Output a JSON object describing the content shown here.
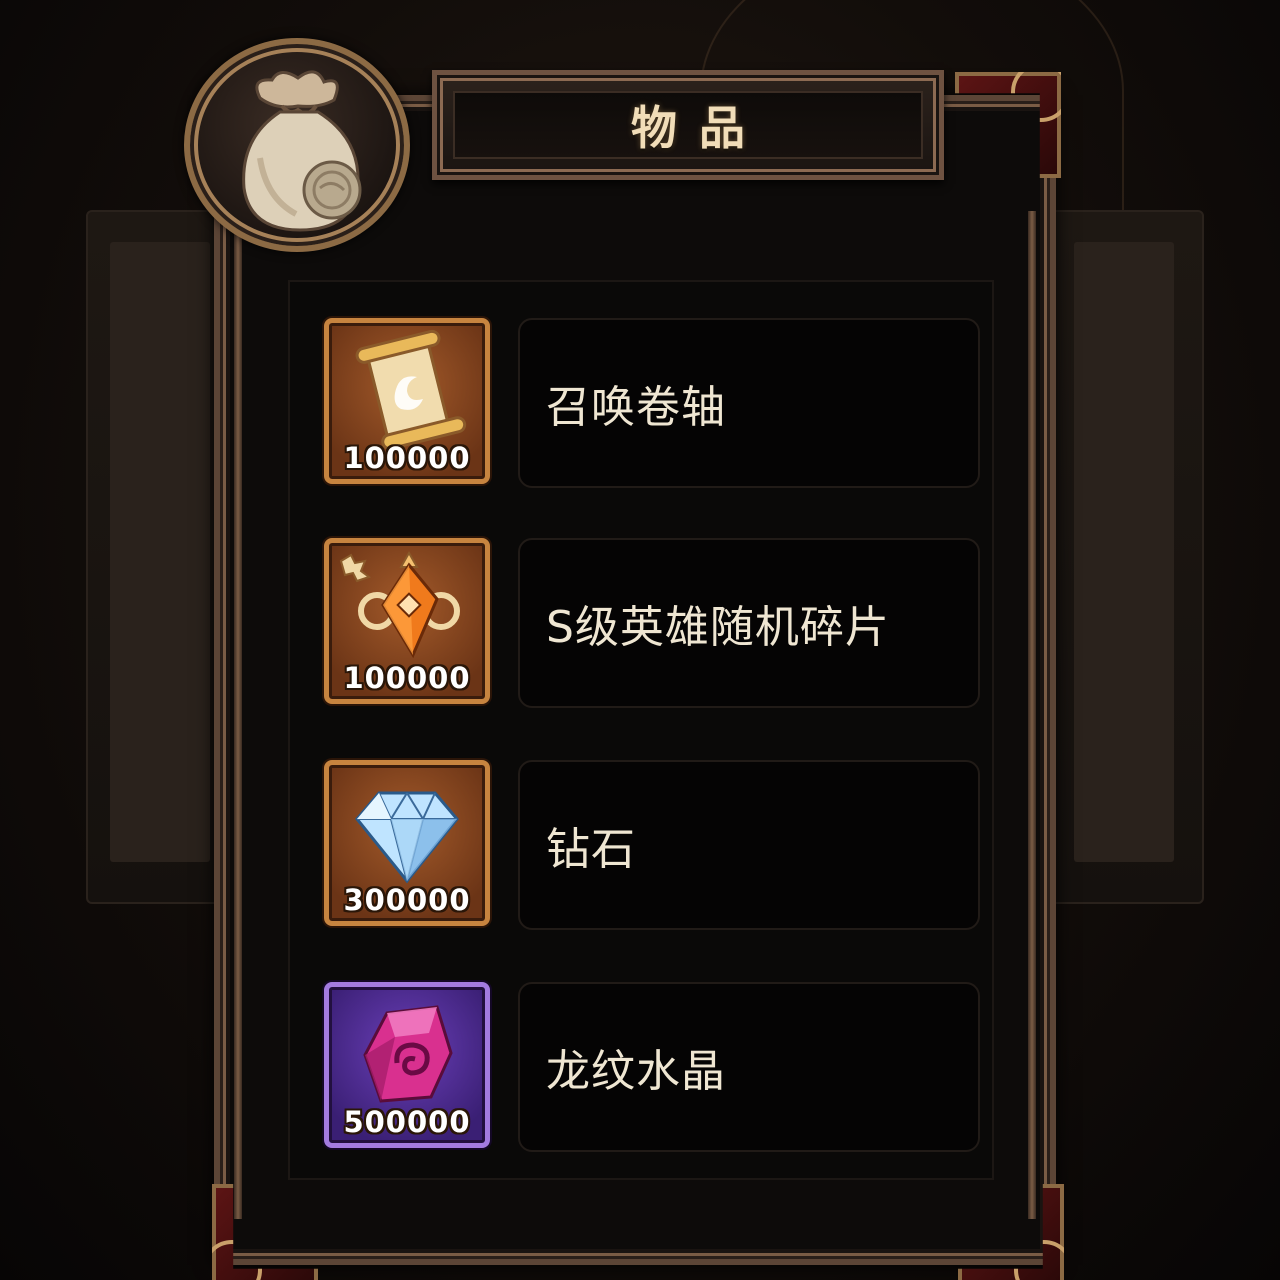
{
  "title": "物品",
  "header_icon": "coin-bag-icon",
  "items": [
    {
      "name": "召唤卷轴",
      "count": "100000",
      "icon": "summon-scroll-icon",
      "rarity_color": "#c7843f"
    },
    {
      "name": "S级英雄随机碎片",
      "count": "100000",
      "icon": "hero-fragment-icon",
      "rarity_color": "#c7843f"
    },
    {
      "name": "钻石",
      "count": "300000",
      "icon": "diamond-icon",
      "rarity_color": "#c7843f"
    },
    {
      "name": "龙纹水晶",
      "count": "500000",
      "icon": "dragon-crystal-icon",
      "rarity_color": "#a37be0"
    }
  ]
}
